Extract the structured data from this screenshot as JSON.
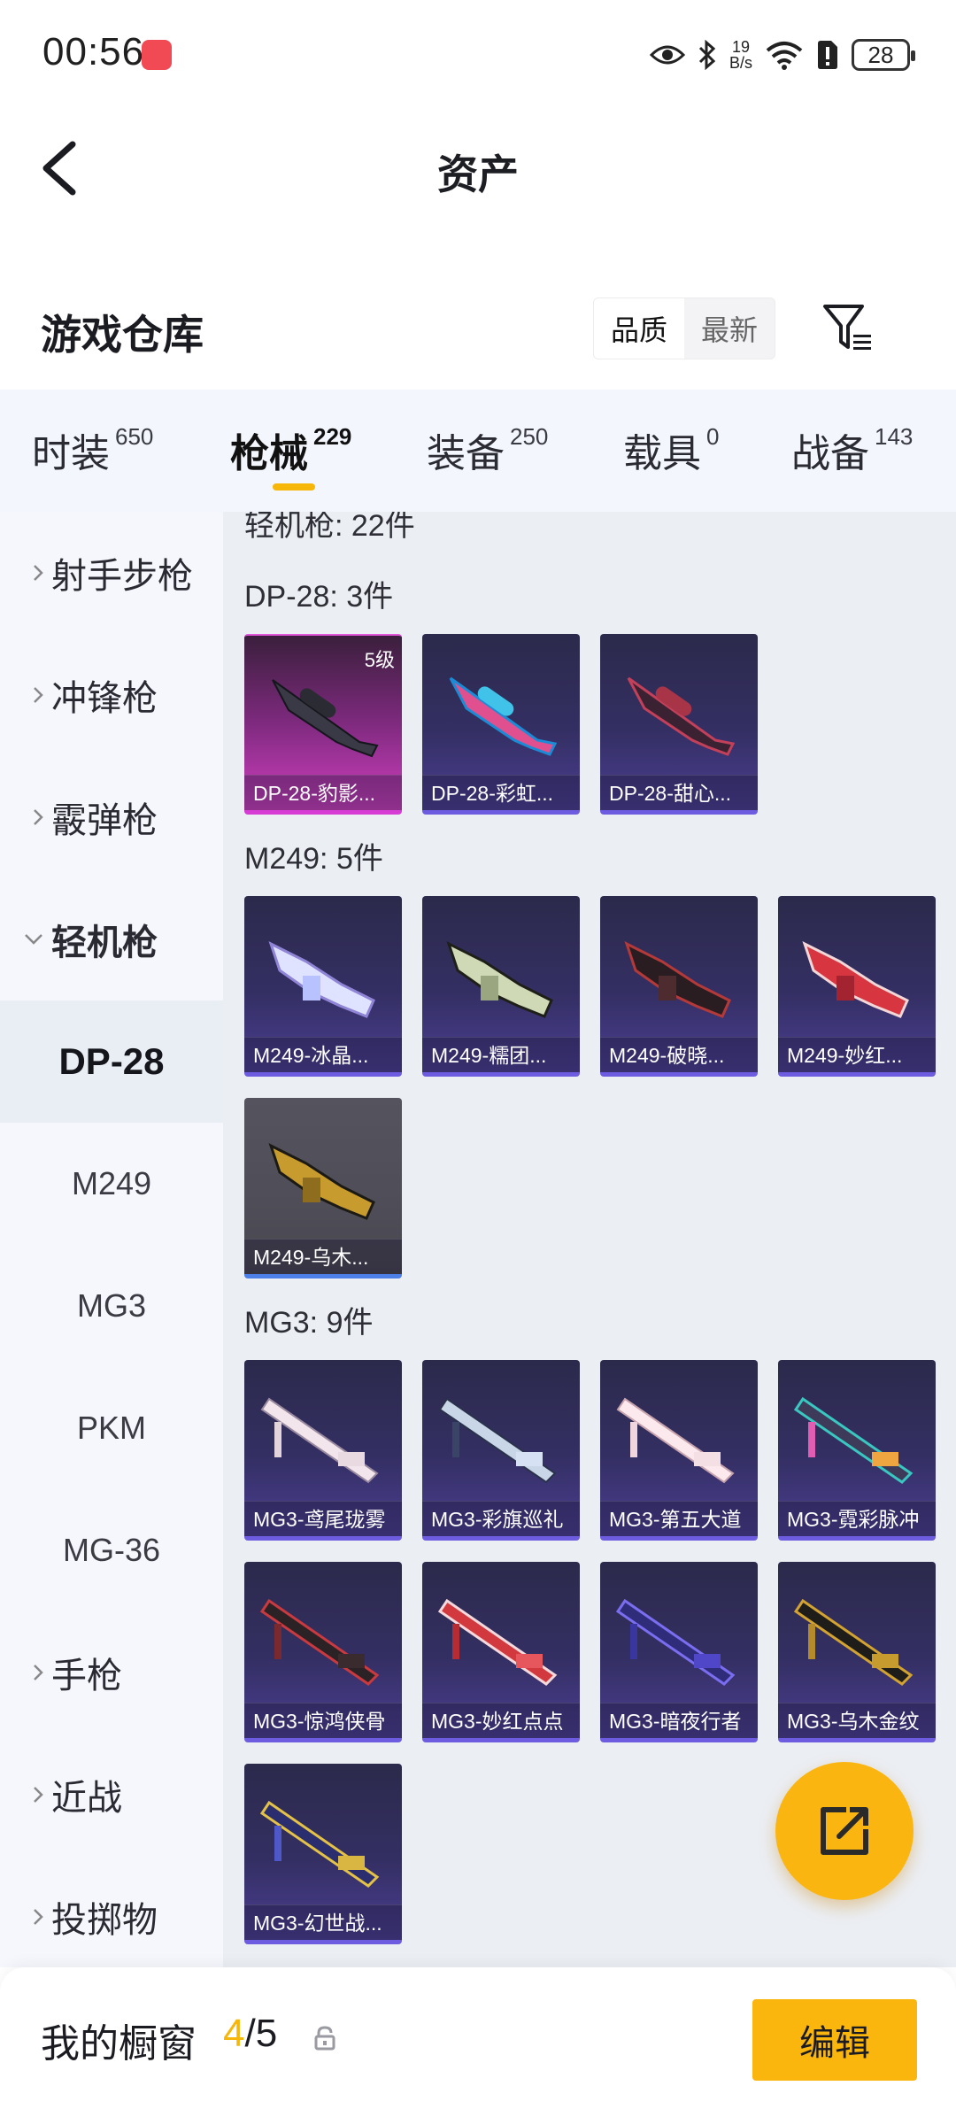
{
  "status_bar": {
    "time": "00:56",
    "net_speed_value": "19",
    "net_speed_unit": "B/s",
    "battery": "28"
  },
  "header": {
    "title": "资产"
  },
  "section": {
    "title": "游戏仓库",
    "sort_options": [
      "品质",
      "最新"
    ],
    "active_sort": "品质"
  },
  "tabs": [
    {
      "label": "时装",
      "count": "650"
    },
    {
      "label": "枪械",
      "count": "229"
    },
    {
      "label": "装备",
      "count": "250"
    },
    {
      "label": "载具",
      "count": "0"
    },
    {
      "label": "战备",
      "count": "143"
    }
  ],
  "active_tab": "枪械",
  "sidebar": {
    "categories": [
      {
        "label": "射手步枪"
      },
      {
        "label": "冲锋枪"
      },
      {
        "label": "霰弹枪"
      },
      {
        "label": "轻机枪"
      }
    ],
    "subitems": [
      "DP-28",
      "M249",
      "MG3",
      "PKM",
      "MG-36"
    ],
    "selected_sub": "DP-28",
    "more_categories": [
      {
        "label": "手枪"
      },
      {
        "label": "近战"
      },
      {
        "label": "投掷物"
      }
    ]
  },
  "content": {
    "partial_header": "轻机枪: 22件",
    "groups": [
      {
        "title": "DP-28: 3件",
        "items": [
          {
            "name": "DP-28-豹影...",
            "level": "5级",
            "style": "pink"
          },
          {
            "name": "DP-28-彩虹...",
            "style": "purple"
          },
          {
            "name": "DP-28-甜心...",
            "style": "purple"
          }
        ]
      },
      {
        "title": "M249: 5件",
        "items": [
          {
            "name": "M249-冰晶...",
            "style": "purple"
          },
          {
            "name": "M249-糯团...",
            "style": "purple"
          },
          {
            "name": "M249-破晓...",
            "style": "purple"
          },
          {
            "name": "M249-妙红...",
            "style": "purple"
          },
          {
            "name": "M249-乌木...",
            "style": "gray"
          }
        ]
      },
      {
        "title": "MG3: 9件",
        "items": [
          {
            "name": "MG3-鸢尾珑雾",
            "style": "purple"
          },
          {
            "name": "MG3-彩旗巡礼",
            "style": "purple"
          },
          {
            "name": "MG3-第五大道",
            "style": "purple"
          },
          {
            "name": "MG3-霓彩脉冲",
            "style": "purple"
          },
          {
            "name": "MG3-惊鸿侠骨",
            "style": "purple"
          },
          {
            "name": "MG3-妙红点点",
            "style": "purple"
          },
          {
            "name": "MG3-暗夜行者",
            "style": "purple"
          },
          {
            "name": "MG3-乌木金纹",
            "style": "purple"
          },
          {
            "name": "MG3-幻世战...",
            "style": "purple"
          }
        ]
      }
    ]
  },
  "bottom": {
    "label": "我的橱窗",
    "current": "4",
    "total": "/5",
    "edit_label": "编辑"
  },
  "colors": {
    "accent": "#fbb60e",
    "card_purple": "#342f63",
    "card_pink": "#d03fc0",
    "card_gray": "#55535d"
  }
}
